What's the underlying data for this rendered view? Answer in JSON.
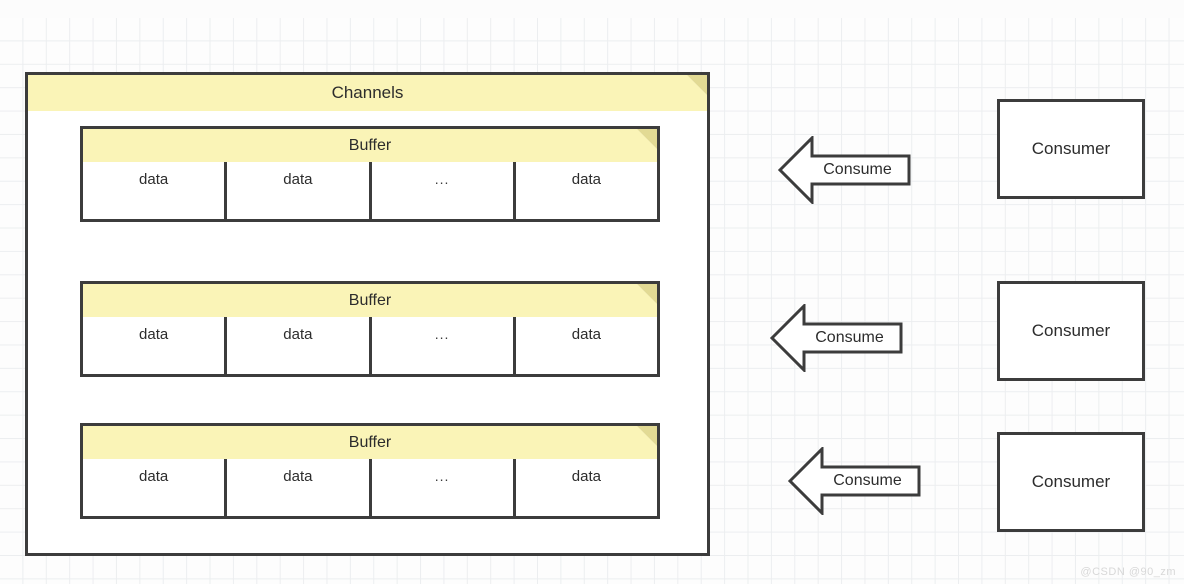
{
  "diagram": {
    "container": {
      "title": "Channels"
    },
    "buffers": [
      {
        "title": "Buffer",
        "cells": [
          "data",
          "data",
          "...",
          "data"
        ]
      },
      {
        "title": "Buffer",
        "cells": [
          "data",
          "data",
          "...",
          "data"
        ]
      },
      {
        "title": "Buffer",
        "cells": [
          "data",
          "data",
          "...",
          "data"
        ]
      }
    ],
    "arrows": [
      {
        "label": "Consume"
      },
      {
        "label": "Consume"
      },
      {
        "label": "Consume"
      }
    ],
    "consumers": [
      {
        "label": "Consumer"
      },
      {
        "label": "Consumer"
      },
      {
        "label": "Consumer"
      }
    ],
    "watermark": "@CSDN @90_zm",
    "colors": {
      "banner_fill": "#faf4b7",
      "banner_fold": "#e2da94",
      "stroke": "#3c3c3c",
      "grid_line": "#eceef0",
      "background": "#fdfdfd"
    }
  }
}
